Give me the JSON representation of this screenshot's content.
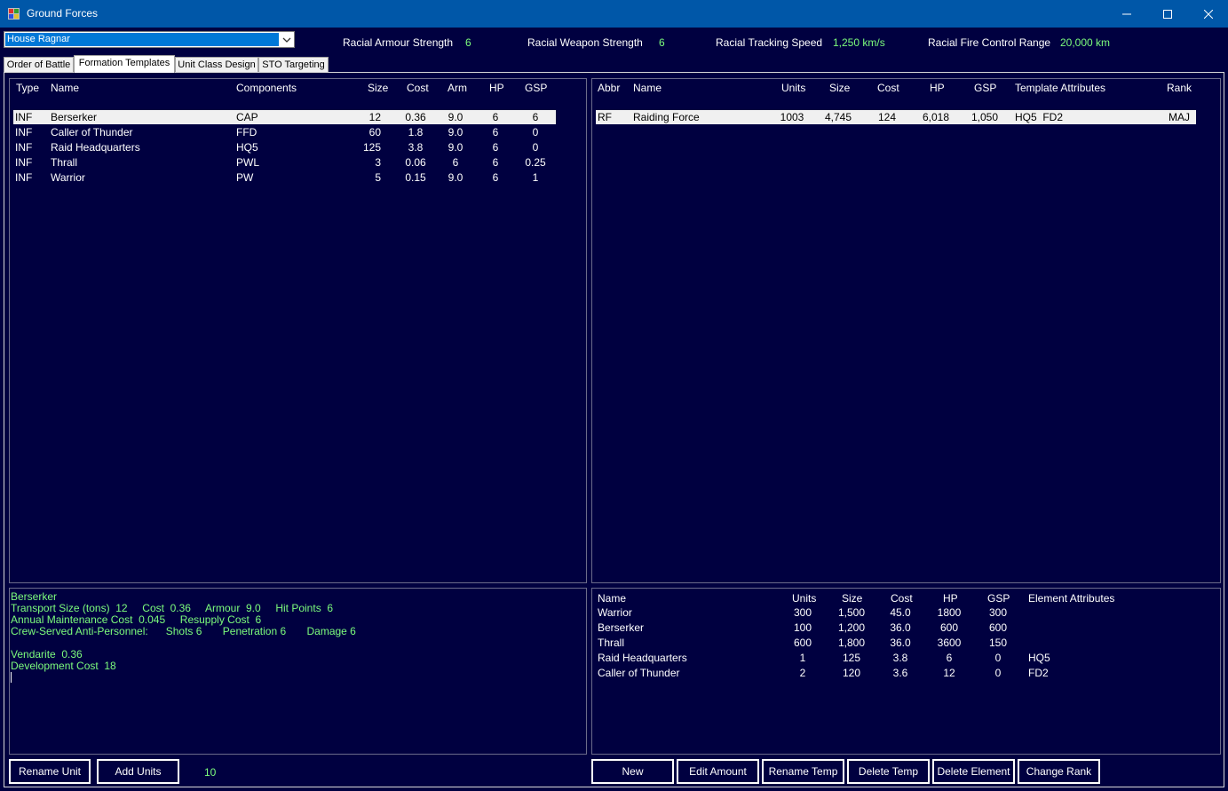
{
  "window": {
    "title": "Ground Forces",
    "app_icon": "app-icon",
    "controls": [
      "minimize-icon",
      "maximize-icon",
      "close-icon"
    ]
  },
  "race_select": {
    "selected": "House Ragnar"
  },
  "racial_stats": {
    "armour_label": "Racial Armour Strength",
    "armour_value": "6",
    "weapon_label": "Racial Weapon Strength",
    "weapon_value": "6",
    "tracking_label": "Racial Tracking Speed",
    "tracking_value": "1,250 km/s",
    "firecontrol_label": "Racial Fire Control Range",
    "firecontrol_value": "20,000 km"
  },
  "tabs": [
    "Order of Battle",
    "Formation Templates",
    "Unit Class Design",
    "STO Targeting"
  ],
  "active_tab": "Formation Templates",
  "unit_classes": {
    "headers": [
      "Type",
      "Name",
      "Components",
      "Size",
      "Cost",
      "Arm",
      "HP",
      "GSP"
    ],
    "rows": [
      [
        "INF",
        "Berserker",
        "CAP",
        "12",
        "0.36",
        "9.0",
        "6",
        "6"
      ],
      [
        "INF",
        "Caller of Thunder",
        "FFD",
        "60",
        "1.8",
        "9.0",
        "6",
        "0"
      ],
      [
        "INF",
        "Raid Headquarters",
        "HQ5",
        "125",
        "3.8",
        "9.0",
        "6",
        "0"
      ],
      [
        "INF",
        "Thrall",
        "PWL",
        "3",
        "0.06",
        "6",
        "6",
        "0.25"
      ],
      [
        "INF",
        "Warrior",
        "PW",
        "5",
        "0.15",
        "9.0",
        "6",
        "1"
      ]
    ],
    "selected_row": 0
  },
  "templates": {
    "headers": [
      "Abbr",
      "Name",
      "Units",
      "Size",
      "Cost",
      "HP",
      "GSP",
      "Template Attributes",
      "Rank"
    ],
    "rows": [
      [
        "RF",
        "Raiding Force",
        "1003",
        "4,745",
        "124",
        "6,018",
        "1,050",
        "HQ5  FD2",
        "MAJ"
      ]
    ],
    "selected_row": 0
  },
  "unit_info": {
    "lines": [
      "Berserker",
      "Transport Size (tons)  12     Cost  0.36     Armour  9.0     Hit Points  6",
      "Annual Maintenance Cost  0.045     Resupply Cost  6",
      "Crew-Served Anti-Personnel:      Shots 6       Penetration 6       Damage 6",
      "",
      "Vendarite  0.36",
      "Development Cost  18"
    ]
  },
  "elements": {
    "headers": [
      "Name",
      "Units",
      "Size",
      "Cost",
      "HP",
      "GSP",
      "Element Attributes"
    ],
    "rows": [
      [
        "Warrior",
        "300",
        "1,500",
        "45.0",
        "1800",
        "300",
        ""
      ],
      [
        "Berserker",
        "100",
        "1,200",
        "36.0",
        "600",
        "600",
        ""
      ],
      [
        "Thrall",
        "600",
        "1,800",
        "36.0",
        "3600",
        "150",
        ""
      ],
      [
        "Raid Headquarters",
        "1",
        "125",
        "3.8",
        "6",
        "0",
        "HQ5"
      ],
      [
        "Caller of Thunder",
        "2",
        "120",
        "3.6",
        "12",
        "0",
        "FD2"
      ]
    ]
  },
  "left_buttons": {
    "rename_unit": "Rename Unit",
    "add_units": "Add Units",
    "add_amount": "10"
  },
  "right_buttons": {
    "new": "New",
    "edit_amount": "Edit Amount",
    "rename_temp": "Rename Temp",
    "delete_temp": "Delete Temp",
    "delete_element": "Delete Element",
    "change_rank": "Change Rank"
  },
  "colors": {
    "background": "#000040",
    "titlebar": "#0057a8",
    "value_green": "#7cfc7c",
    "selection": "#f0f0f0"
  }
}
